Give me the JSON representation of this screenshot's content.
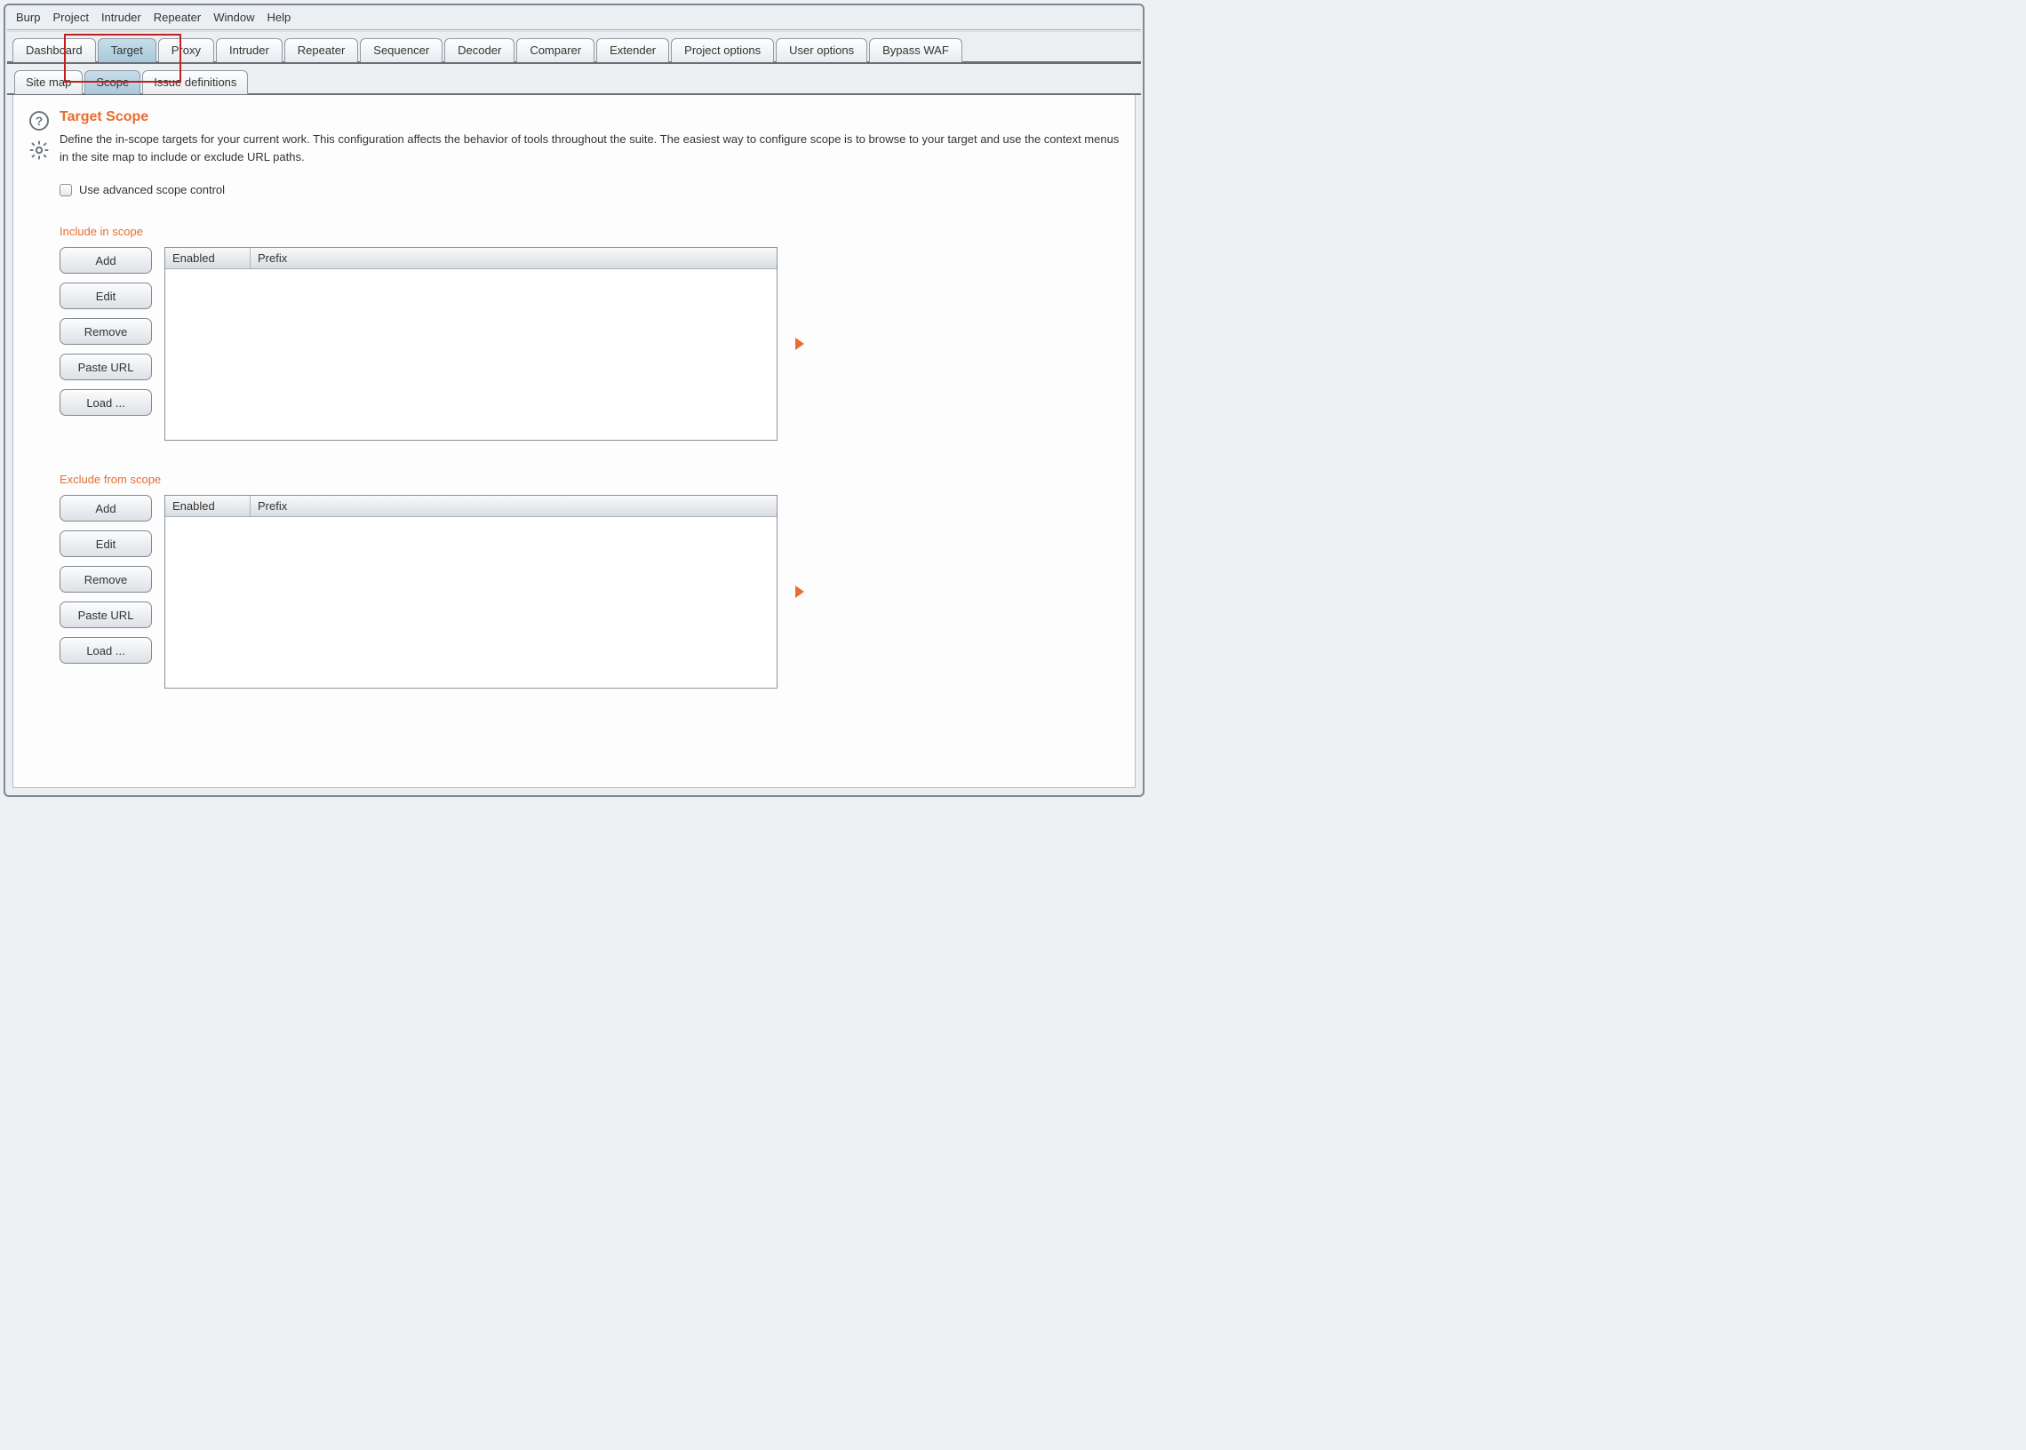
{
  "menubar": [
    "Burp",
    "Project",
    "Intruder",
    "Repeater",
    "Window",
    "Help"
  ],
  "mainTabs": [
    "Dashboard",
    "Target",
    "Proxy",
    "Intruder",
    "Repeater",
    "Sequencer",
    "Decoder",
    "Comparer",
    "Extender",
    "Project options",
    "User options",
    "Bypass WAF"
  ],
  "subTabs": [
    "Site map",
    "Scope",
    "Issue definitions"
  ],
  "heading": "Target Scope",
  "description": "Define the in-scope targets for your current work. This configuration affects the behavior of tools throughout the suite. The easiest way to configure scope is to browse to your target and use the context menus in the site map to include or exclude URL paths.",
  "advancedLabel": "Use advanced scope control",
  "sections": {
    "include": {
      "title": "Include in scope",
      "buttons": [
        "Add",
        "Edit",
        "Remove",
        "Paste URL",
        "Load ..."
      ],
      "columns": [
        "Enabled",
        "Prefix"
      ]
    },
    "exclude": {
      "title": "Exclude from scope",
      "buttons": [
        "Add",
        "Edit",
        "Remove",
        "Paste URL",
        "Load ..."
      ],
      "columns": [
        "Enabled",
        "Prefix"
      ]
    }
  }
}
